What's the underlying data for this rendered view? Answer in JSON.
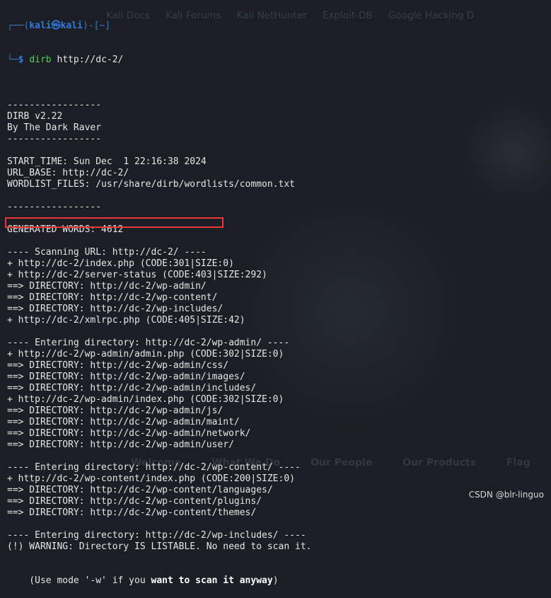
{
  "background": {
    "bookmarks": [
      "Kali Docs",
      "Kali Forums",
      "Kali NetHunter",
      "Exploit-DB",
      "Google Hacking D"
    ],
    "nav": [
      "Welcome",
      "What We Do",
      "Our People",
      "Our Products",
      "Flag"
    ]
  },
  "prompt": {
    "top_open": "┌──(",
    "user": "kali㉿kali",
    "top_close": ")-[~]",
    "bottom": "└─",
    "dollar": "$ ",
    "cmd": "dirb",
    "args": " http://dc-2/"
  },
  "output": [
    "",
    "-----------------",
    "DIRB v2.22",
    "By The Dark Raver",
    "-----------------",
    "",
    "START_TIME: Sun Dec  1 22:16:38 2024",
    "URL_BASE: http://dc-2/",
    "WORDLIST_FILES: /usr/share/dirb/wordlists/common.txt",
    "",
    "-----------------",
    "",
    "GENERATED WORDS: 4612",
    "",
    "---- Scanning URL: http://dc-2/ ----",
    "+ http://dc-2/index.php (CODE:301|SIZE:0)",
    "+ http://dc-2/server-status (CODE:403|SIZE:292)",
    "==> DIRECTORY: http://dc-2/wp-admin/",
    "==> DIRECTORY: http://dc-2/wp-content/",
    "==> DIRECTORY: http://dc-2/wp-includes/",
    "+ http://dc-2/xmlrpc.php (CODE:405|SIZE:42)",
    "",
    "---- Entering directory: http://dc-2/wp-admin/ ----",
    "+ http://dc-2/wp-admin/admin.php (CODE:302|SIZE:0)",
    "==> DIRECTORY: http://dc-2/wp-admin/css/",
    "==> DIRECTORY: http://dc-2/wp-admin/images/",
    "==> DIRECTORY: http://dc-2/wp-admin/includes/",
    "+ http://dc-2/wp-admin/index.php (CODE:302|SIZE:0)",
    "==> DIRECTORY: http://dc-2/wp-admin/js/",
    "==> DIRECTORY: http://dc-2/wp-admin/maint/",
    "==> DIRECTORY: http://dc-2/wp-admin/network/",
    "==> DIRECTORY: http://dc-2/wp-admin/user/",
    "",
    "---- Entering directory: http://dc-2/wp-content/ ----",
    "+ http://dc-2/wp-content/index.php (CODE:200|SIZE:0)",
    "==> DIRECTORY: http://dc-2/wp-content/languages/",
    "==> DIRECTORY: http://dc-2/wp-content/plugins/",
    "==> DIRECTORY: http://dc-2/wp-content/themes/",
    "",
    "---- Entering directory: http://dc-2/wp-includes/ ----",
    "(!) WARNING: Directory IS LISTABLE. No need to scan it."
  ],
  "last_line": {
    "prefix": "    (Use mode '-w' if you ",
    "bold": "want to scan it anyway",
    "suffix": ")"
  },
  "watermark": "CSDN @blr-linguo"
}
